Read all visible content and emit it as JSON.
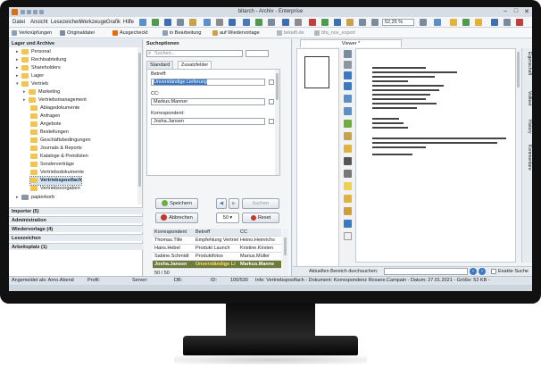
{
  "window": {
    "title": "bitarch - Archiv - Enterprise"
  },
  "menu": [
    "Datei",
    "Ansicht",
    "Lesezeichen",
    "Werkzeuge",
    "Grafik",
    "Hilfe"
  ],
  "zoom": "52,25 %",
  "quickbar": {
    "items": [
      "Verknüpfungen",
      "Originaldatei",
      "Ausgecheckt",
      "in Bearbeitung",
      "auf Wiedervorlage",
      "betaift.de",
      "bfa_nov_export"
    ]
  },
  "left": {
    "header": "Lager und Archive",
    "tree": [
      {
        "label": "Personal"
      },
      {
        "label": "Rechtsabteilung"
      },
      {
        "label": "Shareholders"
      },
      {
        "label": "Lager"
      },
      {
        "label": "Vertrieb"
      },
      {
        "label": "Marketing"
      },
      {
        "label": "Vertriebsmanagement"
      },
      {
        "label": "Ablagedokumente"
      },
      {
        "label": "Anfragen"
      },
      {
        "label": "Angebote"
      },
      {
        "label": "Bestellungen"
      },
      {
        "label": "Geschäftsbedingungen"
      },
      {
        "label": "Journals & Reports"
      },
      {
        "label": "Kataloge & Preislisten"
      },
      {
        "label": "Sonderverträge"
      },
      {
        "label": "Vertriebsdokumente"
      },
      {
        "label": "Vertriebspostfach"
      },
      {
        "label": "Vertriebsvorgaben"
      },
      {
        "label": "papierkorb"
      }
    ],
    "sections": [
      "Importer (5)",
      "Administration",
      "Wiedervorlage (4)",
      "Lesezeichen",
      "Arbeitsplatz (1)"
    ]
  },
  "search": {
    "header": "Suchoptionen",
    "placeholder": "Suchen...",
    "tabs": [
      "Standard",
      "Zusatzfelder"
    ],
    "betreff_label": "Betreff:",
    "betreff_value": "Unverständige Lieferung",
    "cc_label": "CC:",
    "cc_value": "Markus.Manner",
    "korr_label": "Korrespondent:",
    "korr_value": "Josha.Jansen",
    "btn_save": "Speichern",
    "btn_back": "Zurück",
    "btn_forward": "Suchen",
    "btn_cancel": "Abbrechen",
    "count": "50",
    "btn_reset": "Reset",
    "table": {
      "columns": [
        "Korrespondent",
        "Betreff",
        "CC"
      ],
      "rows": [
        [
          "Thomas.Tille",
          "Empfehlung Vertriel",
          "Heino.Heinrichs"
        ],
        [
          "Hans.Hebel",
          "Produkt Launch",
          "Kristine.Kirsten"
        ],
        [
          "Sabine.Schmidt",
          "Produktfotos",
          "Marius.Müller"
        ],
        [
          "Josha.Jansen",
          "Unverständige Li",
          "Markus.Manne"
        ]
      ],
      "paging": "50 / 50"
    }
  },
  "viewer": {
    "tab": "Viewer *",
    "find_label": "Aktuellen Bereich durchsuchen:",
    "exact": "Exakte Suche",
    "side_tabs": [
      "Eigenschaft",
      "Volltext",
      "History",
      "Kommentare"
    ]
  },
  "status": {
    "user": "Angemeldet als: Arno.Abend",
    "profil": "Profil:",
    "server": "Server:",
    "db": "DB:",
    "id": "ID:",
    "pages": "100/530",
    "info": "Info: Vertriebspostfach - Dokument: Korrespondenz Roxane.Campain - Datum: 27.01.2021 - Größe: 52 KB -"
  }
}
